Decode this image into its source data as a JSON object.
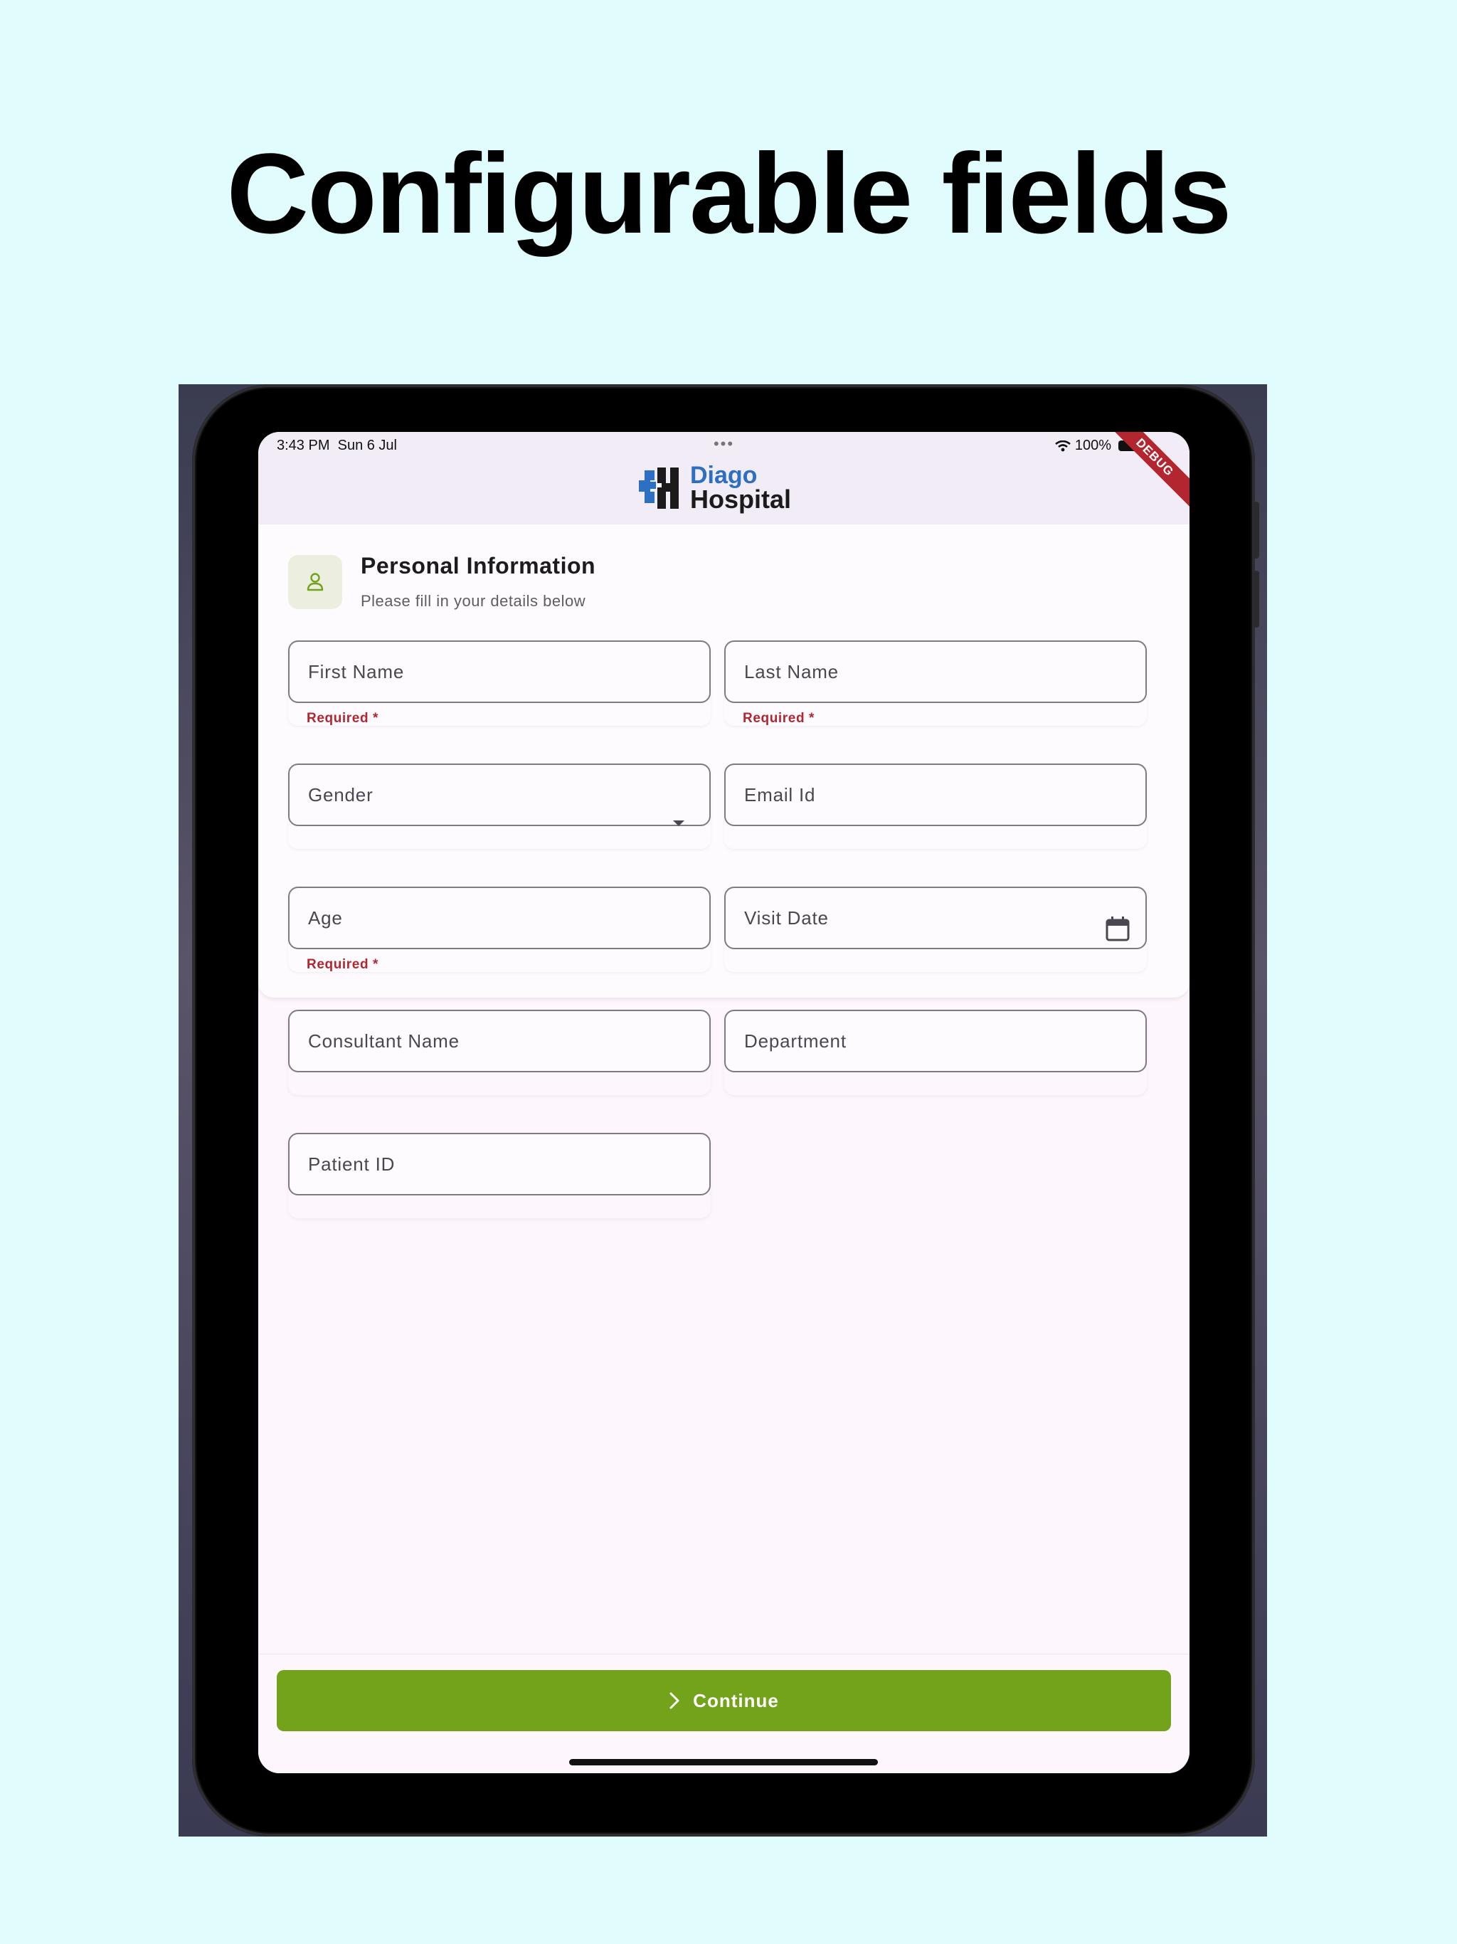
{
  "headline": "Configurable fields",
  "status_bar": {
    "time": "3:43 PM",
    "date": "Sun 6 Jul",
    "battery": "100%",
    "debug_label": "DEBUG"
  },
  "logo": {
    "line1": "Diago",
    "line2": "Hospital"
  },
  "section": {
    "title": "Personal Information",
    "subtitle": "Please fill in your details below",
    "icon": "person-icon"
  },
  "fields": {
    "first_name": {
      "label": "First Name",
      "helper": "Required *"
    },
    "last_name": {
      "label": "Last Name",
      "helper": "Required *"
    },
    "gender": {
      "label": "Gender",
      "icon": "dropdown-arrow-icon"
    },
    "email": {
      "label": "Email Id"
    },
    "age": {
      "label": "Age",
      "helper": "Required *"
    },
    "visit_date": {
      "label": "Visit Date",
      "icon": "calendar-icon"
    },
    "consultant": {
      "label": "Consultant Name"
    },
    "department": {
      "label": "Department"
    },
    "patient_id": {
      "label": "Patient ID"
    }
  },
  "continue_button": {
    "label": "Continue",
    "icon": "chevron-right-icon"
  },
  "colors": {
    "page_bg": "#e0fcfc",
    "accent_green": "#72a31a",
    "error_red": "#b3262f",
    "logo_blue": "#2d6fc2"
  }
}
